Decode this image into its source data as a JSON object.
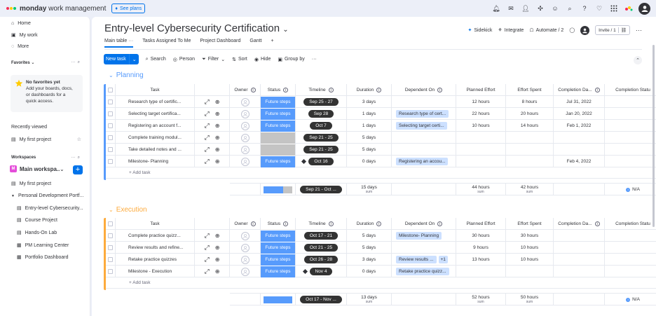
{
  "app": {
    "logo_text_bold": "monday",
    "logo_text_rest": " work management",
    "see_plans": "See plans"
  },
  "sidebar": {
    "home": "Home",
    "my_work": "My work",
    "more": "More",
    "favorites_label": "Favorites",
    "fav_title": "No favorites yet",
    "fav_desc": "Add your boards, docs, or dashboards for a quick access.",
    "recently_viewed": "Recently viewed",
    "recent_board": "My first project",
    "workspaces_label": "Workspaces",
    "ws_badge": "M",
    "ws_name": "Main workspa...",
    "ws_items": [
      "My first project",
      "Personal Development Portf...",
      "Entry-level Cybersecurity...",
      "Course Project",
      "Hands-On Lab",
      "PM Learning Center",
      "Portfolio Dashboard"
    ]
  },
  "board": {
    "title": "Entry-level Cybersecurity Certification",
    "sidekick": "Sidekick",
    "integrate": "Integrate",
    "automate": "Automate / 2",
    "invite": "Invite / 1",
    "tabs": [
      "Main table",
      "Tasks Assigned To Me",
      "Project Dashboard",
      "Gantt"
    ],
    "tab_add": "+",
    "toolbar": {
      "new_task": "New task",
      "search": "Search",
      "person": "Person",
      "filter": "Filter",
      "sort": "Sort",
      "hide": "Hide",
      "group_by": "Group by",
      "more": "···"
    }
  },
  "columns": {
    "task": "Task",
    "owner": "Owner",
    "status": "Status",
    "timeline": "Timeline",
    "duration": "Duration",
    "dependent_on": "Dependent On",
    "planned_effort": "Planned Effort",
    "effort_spent": "Effort Spent",
    "completion_date": "Completion Da...",
    "completion_status": "Completion Statu"
  },
  "groups": [
    {
      "name": "Planning",
      "color": "#579bfc",
      "rows": [
        {
          "task": "Research type of certific...",
          "status": "Future steps",
          "timeline": "Sep 25 - 27",
          "duration": "3 days",
          "dep": "",
          "dep_more": "",
          "planned": "12 hours",
          "spent": "8 hours",
          "date": "Jul 31, 2022",
          "milestone": false
        },
        {
          "task": "Selecting target certifica...",
          "status": "Future steps",
          "timeline": "Sep 28",
          "duration": "1 days",
          "dep": "Research type of cert...",
          "dep_more": "",
          "planned": "22 hours",
          "spent": "20 hours",
          "date": "Jan 20, 2022",
          "milestone": false
        },
        {
          "task": "Registering an account f...",
          "status": "Future steps",
          "timeline": "Oct 7",
          "duration": "1 days",
          "dep": "Selecting target certi...",
          "dep_more": "",
          "planned": "10 hours",
          "spent": "14 hours",
          "date": "Feb 1, 2022",
          "milestone": false
        },
        {
          "task": "Complete training modul...",
          "status": "",
          "timeline": "Sep 21 - 25",
          "duration": "5 days",
          "dep": "",
          "dep_more": "",
          "planned": "",
          "spent": "",
          "date": "",
          "milestone": false
        },
        {
          "task": "Take detailed notes and ...",
          "status": "",
          "timeline": "Sep 21 - 25",
          "duration": "5 days",
          "dep": "",
          "dep_more": "",
          "planned": "",
          "spent": "",
          "date": "",
          "milestone": false
        },
        {
          "task": "Milestone- Planning",
          "status": "Future steps",
          "timeline": "Oct 16",
          "duration": "0 days",
          "dep": "Registering an accou...",
          "dep_more": "",
          "planned": "",
          "spent": "",
          "date": "Feb 4, 2022",
          "milestone": true
        }
      ],
      "add_task": "+ Add task",
      "summary": {
        "timeline": "Sep 21 - Oct ...",
        "duration": "15 days",
        "duration_lbl": "sum",
        "planned": "44 hours",
        "planned_lbl": "sum",
        "spent": "42 hours",
        "spent_lbl": "sum",
        "comp_status": "N/A",
        "status_bar_blue_fraction": 0.68
      }
    },
    {
      "name": "Execution",
      "color": "#fdab3d",
      "rows": [
        {
          "task": "Complete practice quizz...",
          "status": "Future steps",
          "timeline": "Oct 17 - 21",
          "duration": "5 days",
          "dep": "Milestone- Planning",
          "dep_more": "",
          "planned": "30 hours",
          "spent": "30 hours",
          "date": "",
          "milestone": false
        },
        {
          "task": "Review results and refine...",
          "status": "Future steps",
          "timeline": "Oct 21 - 25",
          "duration": "5 days",
          "dep": "",
          "dep_more": "",
          "planned": "9 hours",
          "spent": "10 hours",
          "date": "",
          "milestone": false
        },
        {
          "task": "Retake practice quizzes",
          "status": "Future steps",
          "timeline": "Oct 26 - 28",
          "duration": "3 days",
          "dep": "Review results ...",
          "dep_more": "+1",
          "planned": "13 hours",
          "spent": "10 hours",
          "date": "",
          "milestone": false
        },
        {
          "task": "Milestone - Execution",
          "status": "Future steps",
          "timeline": "Nov 4",
          "duration": "0 days",
          "dep": "Retake practice quizz...",
          "dep_more": "",
          "planned": "",
          "spent": "",
          "date": "",
          "milestone": true
        }
      ],
      "add_task": "+ Add task",
      "summary": {
        "timeline": "Oct 17 - Nov ...",
        "duration": "13 days",
        "duration_lbl": "sum",
        "planned": "52 hours",
        "planned_lbl": "sum",
        "spent": "50 hours",
        "spent_lbl": "sum",
        "comp_status": "N/A",
        "status_bar_blue_fraction": 1.0
      }
    }
  ],
  "colors": {
    "primary": "#0073ea",
    "status_future": "#579bfc",
    "status_empty": "#c4c4c4",
    "planning": "#579bfc",
    "execution": "#fdab3d"
  }
}
